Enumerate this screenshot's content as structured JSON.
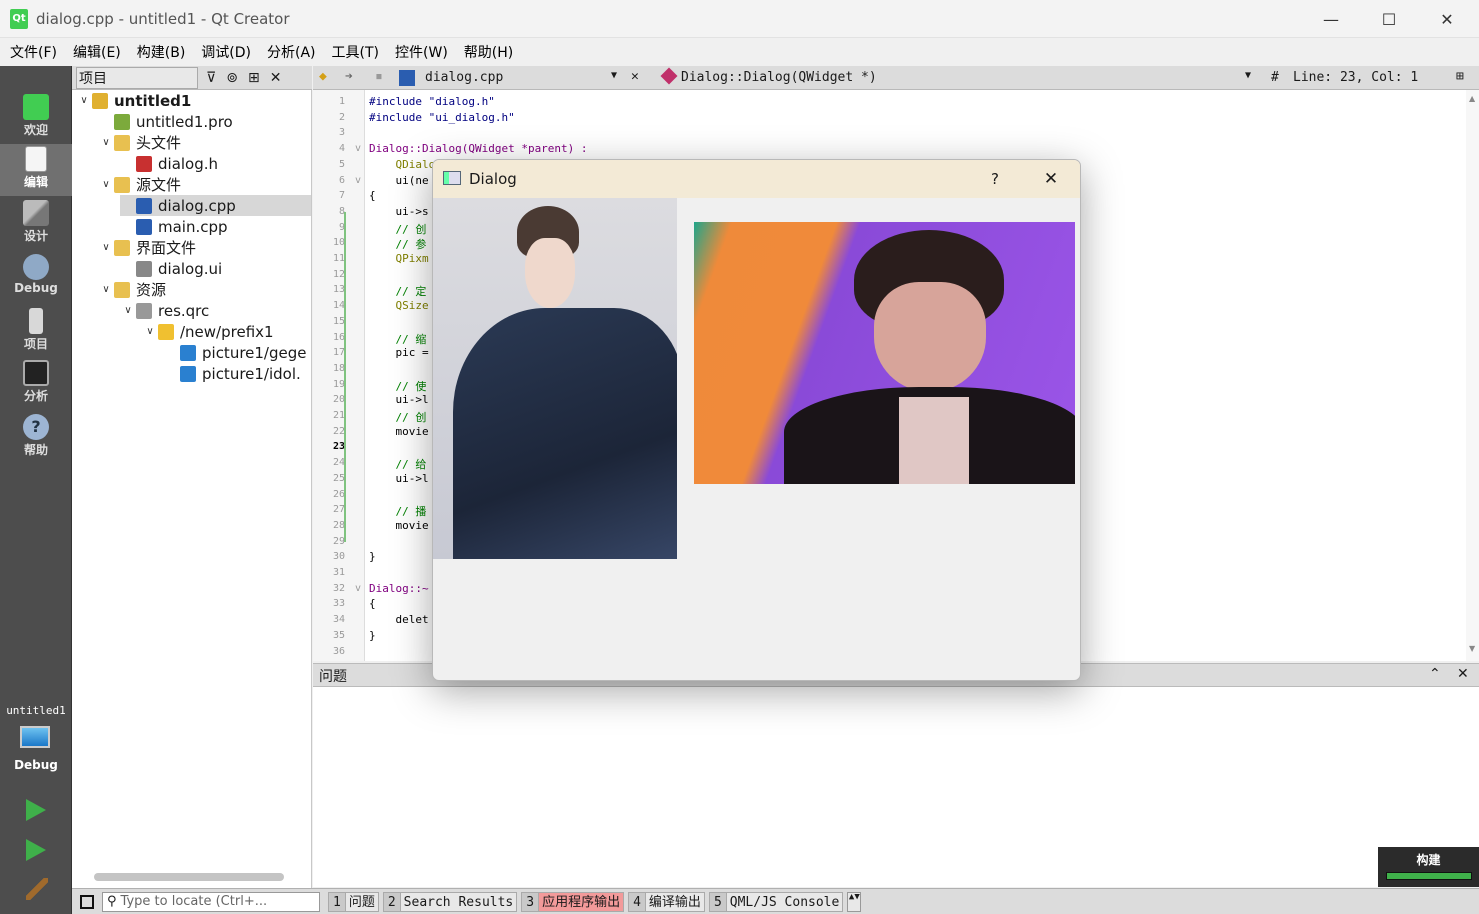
{
  "window": {
    "title": "dialog.cpp - untitled1 - Qt Creator",
    "app_icon": "Qt",
    "minimize": "—",
    "maximize": "☐",
    "close": "✕"
  },
  "menu": [
    "文件(F)",
    "编辑(E)",
    "构建(B)",
    "调试(D)",
    "分析(A)",
    "工具(T)",
    "控件(W)",
    "帮助(H)"
  ],
  "modes": [
    {
      "label": "欢迎",
      "icon": "qt-welcome-icon"
    },
    {
      "label": "编辑",
      "icon": "edit-document-icon"
    },
    {
      "label": "设计",
      "icon": "design-tools-icon"
    },
    {
      "label": "Debug",
      "icon": "debug-bug-icon"
    },
    {
      "label": "项目",
      "icon": "project-wrench-icon"
    },
    {
      "label": "分析",
      "icon": "analyze-monitor-icon"
    },
    {
      "label": "帮助",
      "icon": "help-question-icon"
    }
  ],
  "kit": {
    "project": "untitled1",
    "config": "Debug"
  },
  "build_label": "构建",
  "project_panel": {
    "title": "项目"
  },
  "tree": [
    {
      "label": "untitled1",
      "depth": 0,
      "arrow": "v",
      "bold": true,
      "color": "#e0b030"
    },
    {
      "label": "untitled1.pro",
      "depth": 1,
      "arrow": "",
      "color": "#7caa3c"
    },
    {
      "label": "头文件",
      "depth": 1,
      "arrow": "v",
      "color": "#e8c050"
    },
    {
      "label": "dialog.h",
      "depth": 2,
      "arrow": "",
      "color": "#c83030"
    },
    {
      "label": "源文件",
      "depth": 1,
      "arrow": "v",
      "color": "#e8c050"
    },
    {
      "label": "dialog.cpp",
      "depth": 2,
      "arrow": "",
      "color": "#2a5db0",
      "selected": true
    },
    {
      "label": "main.cpp",
      "depth": 2,
      "arrow": "",
      "color": "#2a5db0"
    },
    {
      "label": "界面文件",
      "depth": 1,
      "arrow": "v",
      "color": "#e8c050"
    },
    {
      "label": "dialog.ui",
      "depth": 2,
      "arrow": "",
      "color": "#888888"
    },
    {
      "label": "资源",
      "depth": 1,
      "arrow": "v",
      "color": "#e8c050"
    },
    {
      "label": "res.qrc",
      "depth": 2,
      "arrow": "v",
      "color": "#999999"
    },
    {
      "label": "/new/prefix1",
      "depth": 3,
      "arrow": "v",
      "color": "#f0c030"
    },
    {
      "label": "picture1/gege",
      "depth": 4,
      "arrow": "",
      "color": "#2a80d0"
    },
    {
      "label": "picture1/idol.",
      "depth": 4,
      "arrow": "",
      "color": "#2a80d0"
    }
  ],
  "editor_header": {
    "file": "dialog.cpp",
    "symbol": "Dialog::Dialog(QWidget *)",
    "hash": "#",
    "position": "Line: 23, Col: 1"
  },
  "code_lines": [
    "#include \"dialog.h\"",
    "#include \"ui_dialog.h\"",
    "",
    "Dialog::Dialog(QWidget *parent) :",
    "    QDialo",
    "    ui(ne",
    "{",
    "    ui->s",
    "    // 创",
    "    // 参",
    "    QPixm",
    "",
    "    // 定",
    "    QSize",
    "",
    "    // 缩",
    "    pic =",
    "",
    "    // 使",
    "    ui->l",
    "    // 创",
    "    movie",
    "",
    "    // 给",
    "    ui->l",
    "",
    "    // 播",
    "    movie",
    "",
    "}",
    "",
    "Dialog::~",
    "{",
    "    delet",
    "}",
    ""
  ],
  "issues_title": "问题",
  "locator_placeholder": "Type to locate (Ctrl+...",
  "output_panes": [
    {
      "n": "1",
      "label": "问题"
    },
    {
      "n": "2",
      "label": "Search Results"
    },
    {
      "n": "3",
      "label": "应用程序输出",
      "alert": true
    },
    {
      "n": "4",
      "label": "编译输出"
    },
    {
      "n": "5",
      "label": "QML/JS Console"
    }
  ],
  "dialog": {
    "title": "Dialog",
    "help": "?",
    "close": "✕"
  }
}
